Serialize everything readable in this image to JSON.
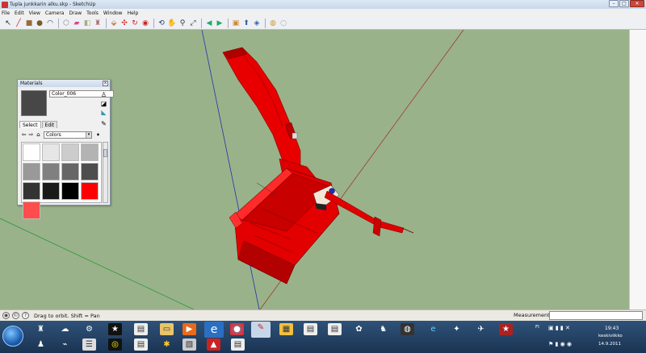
{
  "window": {
    "title": "Tupla junkkarin alku.skp - SketchUp",
    "buttons": {
      "minimize": "–",
      "maximize": "□",
      "close": "✕"
    }
  },
  "menu": [
    "File",
    "Edit",
    "View",
    "Camera",
    "Draw",
    "Tools",
    "Window",
    "Help"
  ],
  "toolbar": {
    "tools": [
      {
        "name": "select-tool",
        "glyph": "↖",
        "color": "#222"
      },
      {
        "name": "line-tool",
        "glyph": "╱",
        "color": "#c22"
      },
      {
        "name": "rectangle-tool",
        "glyph": "■",
        "color": "#9a6a3a"
      },
      {
        "name": "circle-tool",
        "glyph": "●",
        "color": "#7a5a2a"
      },
      {
        "name": "arc-tool",
        "glyph": "◠",
        "color": "#333"
      },
      {
        "name": "sep"
      },
      {
        "name": "make-component-tool",
        "glyph": "⬡",
        "color": "#888"
      },
      {
        "name": "eraser-tool",
        "glyph": "▰",
        "color": "#d48"
      },
      {
        "name": "tape-measure-tool",
        "glyph": "◧",
        "color": "#aa8"
      },
      {
        "name": "paint-bucket-tool",
        "glyph": "♜",
        "color": "#a66"
      },
      {
        "name": "sep"
      },
      {
        "name": "push-pull-tool",
        "glyph": "⬙",
        "color": "#b84"
      },
      {
        "name": "move-tool",
        "glyph": "✣",
        "color": "#c22"
      },
      {
        "name": "rotate-tool",
        "glyph": "↻",
        "color": "#c22"
      },
      {
        "name": "offset-tool",
        "glyph": "◉",
        "color": "#c22"
      },
      {
        "name": "sep"
      },
      {
        "name": "orbit-tool",
        "glyph": "⟲",
        "color": "#236"
      },
      {
        "name": "pan-tool",
        "glyph": "✋",
        "color": "#777"
      },
      {
        "name": "zoom-tool",
        "glyph": "⚲",
        "color": "#333"
      },
      {
        "name": "zoom-extents-tool",
        "glyph": "⤢",
        "color": "#333"
      },
      {
        "name": "sep"
      },
      {
        "name": "previous-view-tool",
        "glyph": "◀",
        "color": "#2a6"
      },
      {
        "name": "next-view-tool",
        "glyph": "▶",
        "color": "#2a6"
      },
      {
        "name": "sep"
      },
      {
        "name": "get-models-tool",
        "glyph": "▣",
        "color": "#c83"
      },
      {
        "name": "share-model-tool",
        "glyph": "⬆",
        "color": "#369"
      },
      {
        "name": "share-component-tool",
        "glyph": "◈",
        "color": "#36a"
      },
      {
        "name": "sep"
      },
      {
        "name": "google-earth-tool",
        "glyph": "◍",
        "color": "#c93"
      },
      {
        "name": "google-earth-export-tool",
        "glyph": "◌",
        "color": "#777"
      }
    ]
  },
  "materials_panel": {
    "title": "Materials",
    "close": "x",
    "current_name": "Color_006",
    "preview_color": "#474747",
    "tabs": [
      "Select",
      "Edit"
    ],
    "library": "Colors",
    "dropdown_arrow": "▾",
    "swatches": [
      "#ffffff",
      "#e6e6e6",
      "#cccccc",
      "#b3b3b3",
      "#999999",
      "#808080",
      "#666666",
      "#4d4d4d",
      "#333333",
      "#1a1a1a",
      "#000000",
      "#ff0000",
      "#ff4d4d"
    ]
  },
  "status": {
    "hint": "Drag to orbit.  Shift = Pan",
    "measurements_label": "Measurements",
    "measurements_value": ""
  },
  "tray": {
    "lang": "FI",
    "time": "19:43",
    "day": "keskiviikko",
    "date": "14.9.2011"
  }
}
